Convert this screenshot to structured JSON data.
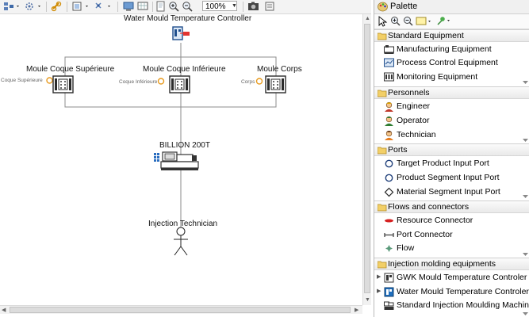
{
  "toolbar": {
    "zoom": "100%",
    "icons": [
      "select-icon",
      "connection-icon",
      "link-icon",
      "layout-icon",
      "arrange-icon",
      "screen-icon",
      "zoom-fit-icon",
      "zoom-in-icon",
      "zoom-out-icon",
      "camera-icon"
    ]
  },
  "diagram": {
    "controller_label": "Water Mould Temperature Controller",
    "moulds": [
      {
        "label": "Moule Coque Supérieure",
        "port_label": "Coque Supérieure"
      },
      {
        "label": "Moule Coque Inférieure",
        "port_label": "Coque Inférieure"
      },
      {
        "label": "Moule Corps",
        "port_label": "Corps"
      }
    ],
    "machine_label": "BILLION 200T",
    "technician_label": "Injection Technician"
  },
  "palette": {
    "title": "Palette",
    "drawers": [
      {
        "title": "Standard Equipment",
        "items": [
          {
            "label": "Manufacturing Equipment",
            "icon": "manufacturing-equipment-icon"
          },
          {
            "label": "Process Control Equipment",
            "icon": "process-control-equipment-icon"
          },
          {
            "label": "Monitoring Equipment",
            "icon": "monitoring-equipment-icon"
          }
        ]
      },
      {
        "title": "Personnels",
        "items": [
          {
            "label": "Engineer",
            "icon": "engineer-icon"
          },
          {
            "label": "Operator",
            "icon": "operator-icon"
          },
          {
            "label": "Technician",
            "icon": "technician-icon"
          }
        ]
      },
      {
        "title": "Ports",
        "items": [
          {
            "label": "Target Product Input Port",
            "icon": "circle-port-icon"
          },
          {
            "label": "Product Segment Input Port",
            "icon": "circle-port-icon"
          },
          {
            "label": "Material Segment Input Port",
            "icon": "diamond-port-icon"
          }
        ]
      },
      {
        "title": "Flows and connectors",
        "items": [
          {
            "label": "Resource Connector",
            "icon": "resource-connector-icon"
          },
          {
            "label": "Port Connector",
            "icon": "port-connector-icon"
          },
          {
            "label": "Flow",
            "icon": "flow-icon"
          }
        ]
      },
      {
        "title": "Injection molding equipments",
        "items": [
          {
            "label": "GWK Mould Temperature Controler",
            "icon": "gwk-controller-icon"
          },
          {
            "label": "Water Mould Temperature Controler",
            "icon": "water-controller-icon"
          },
          {
            "label": "Standard Injection Moulding Machine",
            "icon": "injection-machine-icon"
          }
        ]
      }
    ]
  }
}
